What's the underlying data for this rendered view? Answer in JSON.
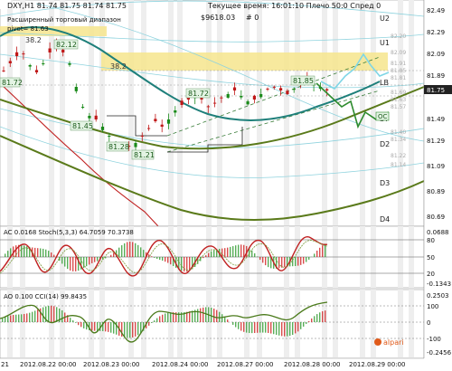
{
  "header": {
    "symbol_line": "DXY,H1  81.74 81.75 81.74 81.75",
    "time_label": "Текущее время: 16:01:10 Плечо 50:0 Спред 0",
    "balance": "$9618.03",
    "extra": "# 0",
    "pivot_caption": "Расширенный торговый диапазон",
    "pivot_value": "pivot= 81.63"
  },
  "main_chart": {
    "levels": [
      "82.20",
      "82.09",
      "81.91",
      "81.85",
      "81.81",
      "81.75",
      "81.69",
      "81.63",
      "81.57",
      "81.52",
      "81.40",
      "81.34",
      "81.29",
      "81.22",
      "81.17",
      "81.14"
    ],
    "level_tags": [
      {
        "name": "U2",
        "text": "U2"
      },
      {
        "name": "U1",
        "text": "U1"
      },
      {
        "name": "LB",
        "text": "LB"
      },
      {
        "name": "ST",
        "text": "ST"
      },
      {
        "name": "D2",
        "text": "D2"
      },
      {
        "name": "D3",
        "text": "D3"
      },
      {
        "name": "D4",
        "text": "D4"
      }
    ],
    "price_axis": [
      "82.49",
      "82.29",
      "82.09",
      "81.89",
      "81.69",
      "81.49",
      "81.29",
      "81.09",
      "80.89",
      "80.69"
    ],
    "current_price": "81.75",
    "annotations": [
      {
        "name": "label-38-2-top",
        "text": "38.2"
      },
      {
        "name": "label-38-2-mid",
        "text": "38.2"
      },
      {
        "name": "label-82-12",
        "text": "82.12"
      },
      {
        "name": "label-81-72",
        "text": "81.72"
      },
      {
        "name": "label-81-45",
        "text": "81.45"
      },
      {
        "name": "label-81-28",
        "text": "81.28"
      },
      {
        "name": "label-81-21",
        "text": "81.21"
      },
      {
        "name": "label-81-72b",
        "text": "81.72"
      },
      {
        "name": "label-81-85",
        "text": "81.85"
      }
    ],
    "oc_badge": "OC"
  },
  "ac_panel": {
    "title": "AC 0.0168  Stoch(5,3,3) 64.7059 70.3738",
    "axis": [
      "0.0688",
      "80",
      "50",
      "20",
      "-0.1343"
    ]
  },
  "ao_panel": {
    "title": "AO 0.100  CCI(14) 99.8435",
    "axis": [
      "0.2503",
      "100",
      "0",
      "-100",
      "-0.2456"
    ],
    "watermark": "alpari"
  },
  "time_axis": [
    "21",
    "2012.08.22 00:00",
    "2012.08.23 00:00",
    "2012.08.24 00:00",
    "2012.08.27 00:00",
    "2012.08.28 00:00",
    "2012.08.29 00:00"
  ],
  "colors": {
    "ma_teal": "#1e7f7a",
    "ma_olive": "#5a7a1a",
    "ma_red": "#c02020",
    "fib_band": "#f6e58d",
    "candle_up": "#1a8a1a",
    "candle_down": "#c01818"
  }
}
